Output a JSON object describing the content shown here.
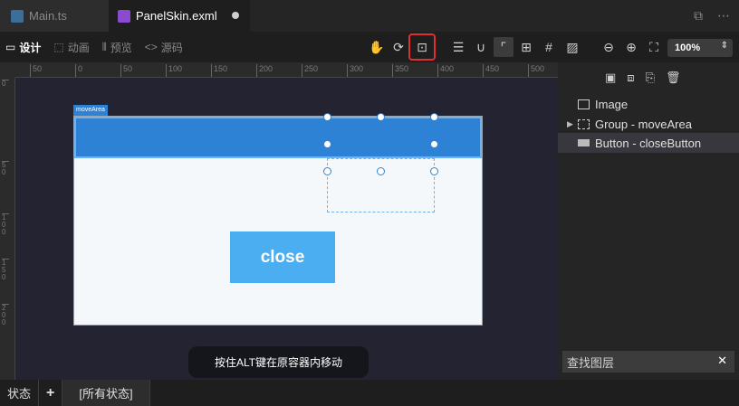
{
  "tabs": [
    {
      "label": "Main.ts",
      "active": false
    },
    {
      "label": "PanelSkin.exml",
      "active": true
    }
  ],
  "toolbar": {
    "modes": [
      "设计",
      "动画",
      "预览",
      "源码"
    ],
    "zoom": "100%"
  },
  "ruler": {
    "h_ticks": [
      "50",
      "0",
      "50",
      "100",
      "150",
      "200",
      "250",
      "300",
      "350",
      "400",
      "450",
      "500"
    ],
    "v_ticks": [
      "0",
      "50",
      "100",
      "150",
      "200"
    ]
  },
  "canvas": {
    "move_area_label": "moveArea",
    "close_label": "close",
    "toast": "按住ALT键在原容器内移动"
  },
  "layers": [
    {
      "label": "Image"
    },
    {
      "label": "Group - moveArea"
    },
    {
      "label": "Button - closeButton"
    }
  ],
  "search": {
    "placeholder": "查找图层"
  },
  "status": {
    "label": "状态",
    "add": "+",
    "all_states": "[所有状态]"
  },
  "colors": {
    "accent": "#2e82d6",
    "button": "#4aaef0",
    "lock_highlight": "#e02f2f"
  }
}
